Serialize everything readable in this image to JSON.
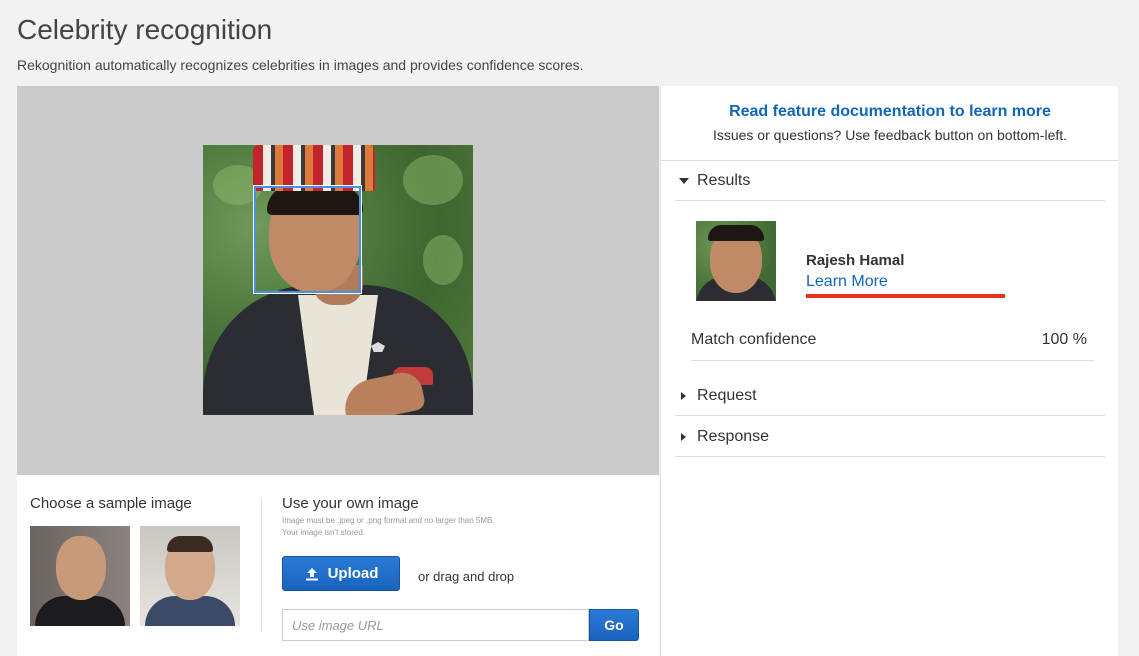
{
  "header": {
    "title": "Celebrity recognition",
    "subtitle": "Rekognition automatically recognizes celebrities in images and provides confidence scores."
  },
  "samples": {
    "title": "Choose a sample image"
  },
  "own_image": {
    "title": "Use your own image",
    "note": "Image must be .jpeg or .png format and no larger than 5MB. Your image isn't stored.",
    "upload_label": "Upload",
    "drag_text": "or drag and drop",
    "url_placeholder": "Use image URL",
    "go_label": "Go"
  },
  "docs": {
    "link_text": "Read feature documentation to learn more",
    "subtext": "Issues or questions? Use feedback button on bottom-left."
  },
  "results": {
    "header": "Results",
    "celebrity_name": "Rajesh Hamal",
    "learn_more": "Learn More",
    "confidence_label": "Match confidence",
    "confidence_value": "100 %"
  },
  "request": {
    "header": "Request"
  },
  "response": {
    "header": "Response"
  },
  "colors": {
    "accent_blue": "#1166bb",
    "button_blue": "#1a63bd",
    "highlight_red": "#e8321e",
    "face_box": "#4a8fe0"
  }
}
